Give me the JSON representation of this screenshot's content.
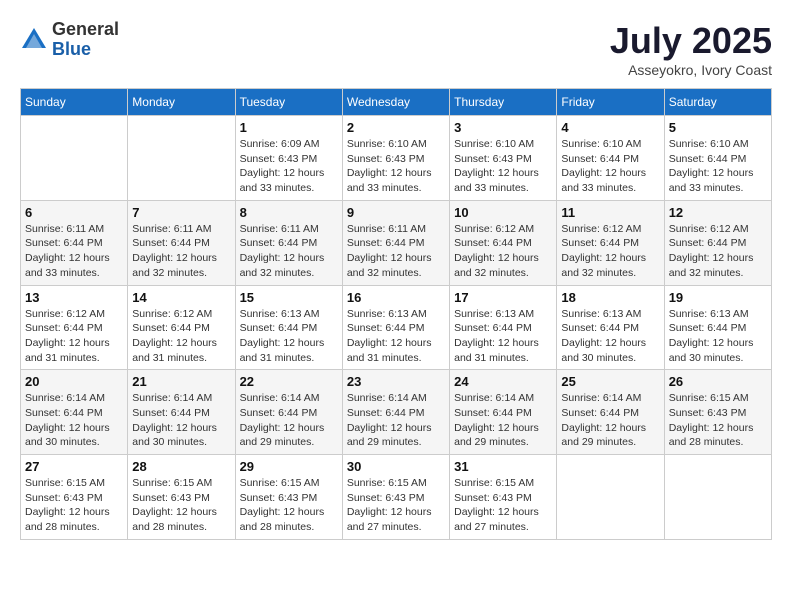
{
  "logo": {
    "general": "General",
    "blue": "Blue"
  },
  "title": "July 2025",
  "subtitle": "Asseyokro, Ivory Coast",
  "days_header": [
    "Sunday",
    "Monday",
    "Tuesday",
    "Wednesday",
    "Thursday",
    "Friday",
    "Saturday"
  ],
  "weeks": [
    [
      {
        "day": "",
        "sunrise": "",
        "sunset": "",
        "daylight": ""
      },
      {
        "day": "",
        "sunrise": "",
        "sunset": "",
        "daylight": ""
      },
      {
        "day": "1",
        "sunrise": "Sunrise: 6:09 AM",
        "sunset": "Sunset: 6:43 PM",
        "daylight": "Daylight: 12 hours and 33 minutes."
      },
      {
        "day": "2",
        "sunrise": "Sunrise: 6:10 AM",
        "sunset": "Sunset: 6:43 PM",
        "daylight": "Daylight: 12 hours and 33 minutes."
      },
      {
        "day": "3",
        "sunrise": "Sunrise: 6:10 AM",
        "sunset": "Sunset: 6:43 PM",
        "daylight": "Daylight: 12 hours and 33 minutes."
      },
      {
        "day": "4",
        "sunrise": "Sunrise: 6:10 AM",
        "sunset": "Sunset: 6:44 PM",
        "daylight": "Daylight: 12 hours and 33 minutes."
      },
      {
        "day": "5",
        "sunrise": "Sunrise: 6:10 AM",
        "sunset": "Sunset: 6:44 PM",
        "daylight": "Daylight: 12 hours and 33 minutes."
      }
    ],
    [
      {
        "day": "6",
        "sunrise": "Sunrise: 6:11 AM",
        "sunset": "Sunset: 6:44 PM",
        "daylight": "Daylight: 12 hours and 33 minutes."
      },
      {
        "day": "7",
        "sunrise": "Sunrise: 6:11 AM",
        "sunset": "Sunset: 6:44 PM",
        "daylight": "Daylight: 12 hours and 32 minutes."
      },
      {
        "day": "8",
        "sunrise": "Sunrise: 6:11 AM",
        "sunset": "Sunset: 6:44 PM",
        "daylight": "Daylight: 12 hours and 32 minutes."
      },
      {
        "day": "9",
        "sunrise": "Sunrise: 6:11 AM",
        "sunset": "Sunset: 6:44 PM",
        "daylight": "Daylight: 12 hours and 32 minutes."
      },
      {
        "day": "10",
        "sunrise": "Sunrise: 6:12 AM",
        "sunset": "Sunset: 6:44 PM",
        "daylight": "Daylight: 12 hours and 32 minutes."
      },
      {
        "day": "11",
        "sunrise": "Sunrise: 6:12 AM",
        "sunset": "Sunset: 6:44 PM",
        "daylight": "Daylight: 12 hours and 32 minutes."
      },
      {
        "day": "12",
        "sunrise": "Sunrise: 6:12 AM",
        "sunset": "Sunset: 6:44 PM",
        "daylight": "Daylight: 12 hours and 32 minutes."
      }
    ],
    [
      {
        "day": "13",
        "sunrise": "Sunrise: 6:12 AM",
        "sunset": "Sunset: 6:44 PM",
        "daylight": "Daylight: 12 hours and 31 minutes."
      },
      {
        "day": "14",
        "sunrise": "Sunrise: 6:12 AM",
        "sunset": "Sunset: 6:44 PM",
        "daylight": "Daylight: 12 hours and 31 minutes."
      },
      {
        "day": "15",
        "sunrise": "Sunrise: 6:13 AM",
        "sunset": "Sunset: 6:44 PM",
        "daylight": "Daylight: 12 hours and 31 minutes."
      },
      {
        "day": "16",
        "sunrise": "Sunrise: 6:13 AM",
        "sunset": "Sunset: 6:44 PM",
        "daylight": "Daylight: 12 hours and 31 minutes."
      },
      {
        "day": "17",
        "sunrise": "Sunrise: 6:13 AM",
        "sunset": "Sunset: 6:44 PM",
        "daylight": "Daylight: 12 hours and 31 minutes."
      },
      {
        "day": "18",
        "sunrise": "Sunrise: 6:13 AM",
        "sunset": "Sunset: 6:44 PM",
        "daylight": "Daylight: 12 hours and 30 minutes."
      },
      {
        "day": "19",
        "sunrise": "Sunrise: 6:13 AM",
        "sunset": "Sunset: 6:44 PM",
        "daylight": "Daylight: 12 hours and 30 minutes."
      }
    ],
    [
      {
        "day": "20",
        "sunrise": "Sunrise: 6:14 AM",
        "sunset": "Sunset: 6:44 PM",
        "daylight": "Daylight: 12 hours and 30 minutes."
      },
      {
        "day": "21",
        "sunrise": "Sunrise: 6:14 AM",
        "sunset": "Sunset: 6:44 PM",
        "daylight": "Daylight: 12 hours and 30 minutes."
      },
      {
        "day": "22",
        "sunrise": "Sunrise: 6:14 AM",
        "sunset": "Sunset: 6:44 PM",
        "daylight": "Daylight: 12 hours and 29 minutes."
      },
      {
        "day": "23",
        "sunrise": "Sunrise: 6:14 AM",
        "sunset": "Sunset: 6:44 PM",
        "daylight": "Daylight: 12 hours and 29 minutes."
      },
      {
        "day": "24",
        "sunrise": "Sunrise: 6:14 AM",
        "sunset": "Sunset: 6:44 PM",
        "daylight": "Daylight: 12 hours and 29 minutes."
      },
      {
        "day": "25",
        "sunrise": "Sunrise: 6:14 AM",
        "sunset": "Sunset: 6:44 PM",
        "daylight": "Daylight: 12 hours and 29 minutes."
      },
      {
        "day": "26",
        "sunrise": "Sunrise: 6:15 AM",
        "sunset": "Sunset: 6:43 PM",
        "daylight": "Daylight: 12 hours and 28 minutes."
      }
    ],
    [
      {
        "day": "27",
        "sunrise": "Sunrise: 6:15 AM",
        "sunset": "Sunset: 6:43 PM",
        "daylight": "Daylight: 12 hours and 28 minutes."
      },
      {
        "day": "28",
        "sunrise": "Sunrise: 6:15 AM",
        "sunset": "Sunset: 6:43 PM",
        "daylight": "Daylight: 12 hours and 28 minutes."
      },
      {
        "day": "29",
        "sunrise": "Sunrise: 6:15 AM",
        "sunset": "Sunset: 6:43 PM",
        "daylight": "Daylight: 12 hours and 28 minutes."
      },
      {
        "day": "30",
        "sunrise": "Sunrise: 6:15 AM",
        "sunset": "Sunset: 6:43 PM",
        "daylight": "Daylight: 12 hours and 27 minutes."
      },
      {
        "day": "31",
        "sunrise": "Sunrise: 6:15 AM",
        "sunset": "Sunset: 6:43 PM",
        "daylight": "Daylight: 12 hours and 27 minutes."
      },
      {
        "day": "",
        "sunrise": "",
        "sunset": "",
        "daylight": ""
      },
      {
        "day": "",
        "sunrise": "",
        "sunset": "",
        "daylight": ""
      }
    ]
  ]
}
